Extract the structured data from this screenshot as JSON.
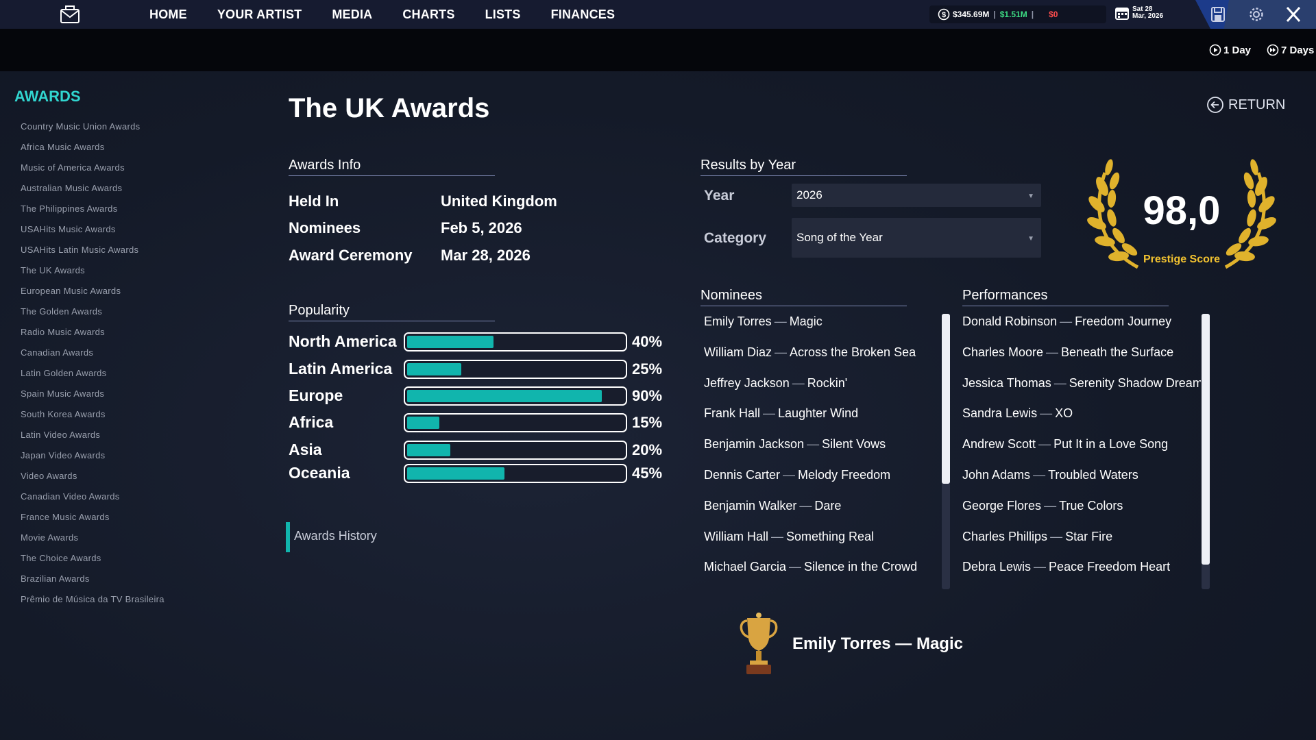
{
  "nav": [
    "HOME",
    "YOUR ARTIST",
    "MEDIA",
    "CHARTS",
    "LISTS",
    "FINANCES"
  ],
  "status": {
    "money": "$345.69M",
    "gain": "$1.51M",
    "loss": "$0",
    "date_line1": "Sat 28",
    "date_line2": "Mar, 2026"
  },
  "speed": {
    "one_day": "1 Day",
    "seven_days": "7 Days"
  },
  "sidebar": {
    "title": "AWARDS",
    "items": [
      "Country Music Union Awards",
      "Africa Music Awards",
      "Music of America Awards",
      "Australian Music Awards",
      "The Philippines Awards",
      "USAHits Music Awards",
      "USAHits Latin Music Awards",
      "The UK Awards",
      "European Music Awards",
      "The Golden Awards",
      "Radio Music Awards",
      "Canadian Awards",
      "Latin Golden Awards",
      "Spain Music Awards",
      "South Korea Awards",
      "Latin Video Awards",
      "Japan Video Awards",
      "Video Awards",
      "Canadian Video Awards",
      "France Music Awards",
      "Movie Awards",
      "The Choice Awards",
      "Brazilian Awards",
      "Prêmio de Música da TV Brasileira"
    ]
  },
  "page": {
    "title": "The UK Awards",
    "return_label": "RETURN"
  },
  "awards_info": {
    "heading": "Awards Info",
    "rows": [
      {
        "label": "Held In",
        "value": "United Kingdom"
      },
      {
        "label": "Nominees",
        "value": "Feb 5, 2026"
      },
      {
        "label": "Award Ceremony",
        "value": "Mar 28, 2026"
      }
    ]
  },
  "popularity": {
    "heading": "Popularity",
    "regions": [
      {
        "name": "North America",
        "percent": 40,
        "label": "40%"
      },
      {
        "name": "Latin America",
        "percent": 25,
        "label": "25%"
      },
      {
        "name": "Europe",
        "percent": 90,
        "label": "90%"
      },
      {
        "name": "Africa",
        "percent": 15,
        "label": "15%"
      },
      {
        "name": "Asia",
        "percent": 20,
        "label": "20%"
      },
      {
        "name": "Oceania",
        "percent": 45,
        "label": "45%"
      }
    ]
  },
  "history_tab": "Awards History",
  "results": {
    "heading": "Results by Year",
    "year_label": "Year",
    "year_value": "2026",
    "category_label": "Category",
    "category_value": "Song of the Year"
  },
  "prestige": {
    "score": "98,0",
    "label": "Prestige Score"
  },
  "nominees": {
    "heading": "Nominees",
    "items": [
      {
        "artist": "Emily Torres",
        "song": "Magic"
      },
      {
        "artist": "William Diaz",
        "song": "Across the Broken Sea"
      },
      {
        "artist": "Jeffrey Jackson",
        "song": "Rockin'"
      },
      {
        "artist": "Frank Hall",
        "song": "Laughter Wind"
      },
      {
        "artist": "Benjamin Jackson",
        "song": "Silent Vows"
      },
      {
        "artist": "Dennis Carter",
        "song": "Melody Freedom"
      },
      {
        "artist": "Benjamin Walker",
        "song": "Dare"
      },
      {
        "artist": "William Hall",
        "song": "Something Real"
      },
      {
        "artist": "Michael Garcia",
        "song": "Silence in the Crowd"
      }
    ]
  },
  "performances": {
    "heading": "Performances",
    "items": [
      {
        "artist": "Donald Robinson",
        "song": "Freedom Journey"
      },
      {
        "artist": "Charles Moore",
        "song": "Beneath the Surface"
      },
      {
        "artist": "Jessica Thomas",
        "song": "Serenity Shadow Dream"
      },
      {
        "artist": "Sandra Lewis",
        "song": "XO"
      },
      {
        "artist": "Andrew Scott",
        "song": "Put It in a Love Song"
      },
      {
        "artist": "John Adams",
        "song": "Troubled Waters"
      },
      {
        "artist": "George Flores",
        "song": "True Colors"
      },
      {
        "artist": "Charles Phillips",
        "song": "Star Fire"
      },
      {
        "artist": "Debra Lewis",
        "song": "Peace Freedom Heart"
      }
    ]
  },
  "winner": {
    "text": "Emily Torres — Magic"
  },
  "colors": {
    "accent": "#31d6d0",
    "bar": "#11b5ad",
    "gold": "#f2c230",
    "gain": "#3ddc84",
    "loss": "#ff4d4d"
  },
  "icons": [
    "mail-icon",
    "coin-icon",
    "calendar-icon",
    "save-icon",
    "gear-icon",
    "close-icon",
    "play-icon",
    "fast-forward-icon",
    "return-arrow-icon",
    "laurel-icon",
    "trophy-icon"
  ]
}
